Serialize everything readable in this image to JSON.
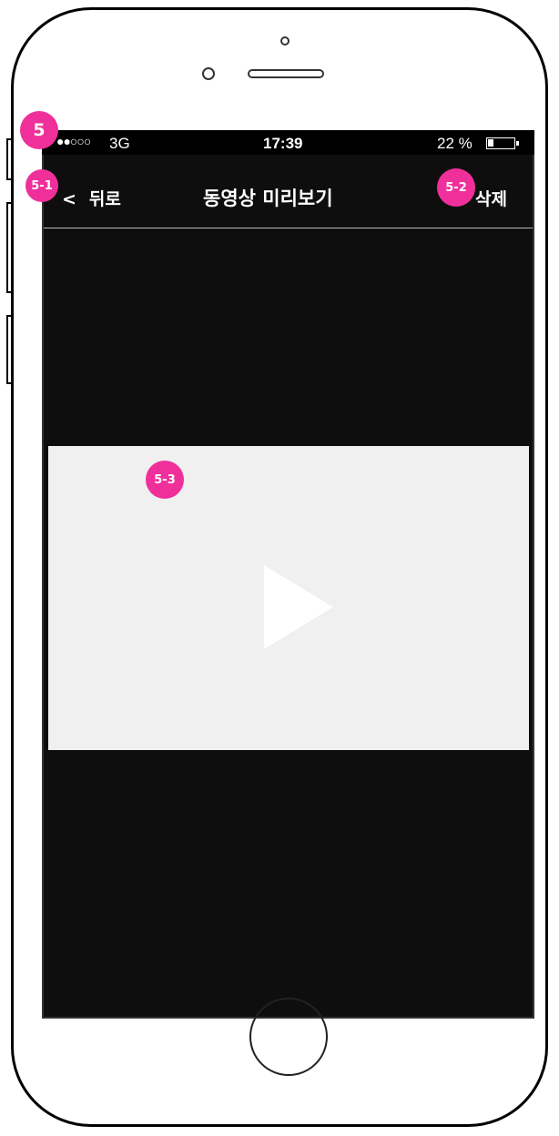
{
  "status_bar": {
    "signal": "●●○○○",
    "carrier": "3G",
    "time": "17:39",
    "battery_percent": "22 %"
  },
  "nav": {
    "back_chevron": "<",
    "back_label": "뒤로",
    "title": "동영상 미리보기",
    "delete_label": "삭제"
  },
  "annotations": {
    "screen": "5",
    "back": "5-1",
    "delete": "5-2",
    "video": "5-3"
  },
  "colors": {
    "screen_bg": "#0e0e0e",
    "video_bg": "#f0f0f0",
    "badge": "#f0309a"
  },
  "icons": [
    "play-icon",
    "battery-icon"
  ]
}
